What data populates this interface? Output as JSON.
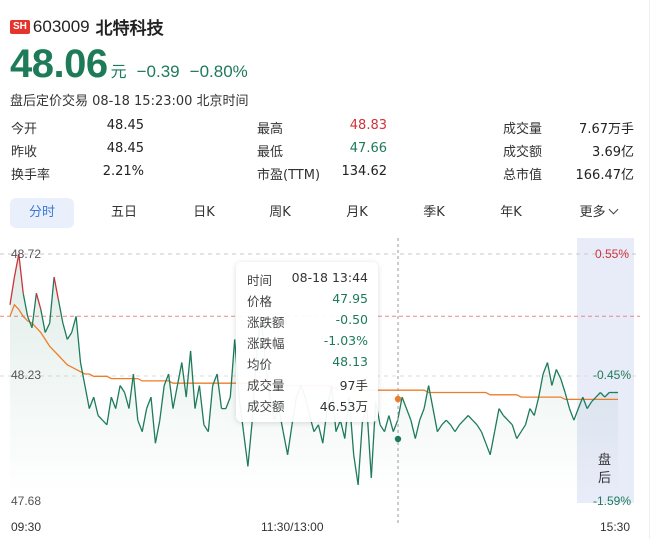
{
  "header": {
    "exchange": "SH",
    "code": "603009",
    "name": "北特科技"
  },
  "quote": {
    "price": "48.06",
    "unit": "元",
    "change": "−0.39",
    "change_pct": "−0.80%",
    "status": "盘后定价交易 08-18 15:23:00 北京时间"
  },
  "stats": [
    {
      "label": "今开",
      "value": "48.45"
    },
    {
      "label": "最高",
      "value": "48.83",
      "color": "#d0323a"
    },
    {
      "label": "成交量",
      "value": "7.67万手"
    },
    {
      "label": "昨收",
      "value": "48.45"
    },
    {
      "label": "最低",
      "value": "47.66",
      "color": "#1e7b5a"
    },
    {
      "label": "成交额",
      "value": "3.69亿"
    },
    {
      "label": "换手率",
      "value": "2.21%"
    },
    {
      "label": "市盈(TTM)",
      "value": "134.62"
    },
    {
      "label": "总市值",
      "value": "166.47亿"
    }
  ],
  "tabs": [
    "分时",
    "五日",
    "日K",
    "周K",
    "月K",
    "季K",
    "年K",
    "更多"
  ],
  "chart": {
    "y_top_label": "48.72",
    "y_mid_label": "48.23",
    "y_bottom_label": "47.68",
    "pct_top_label": "0.55%",
    "pct_mid_label": "-0.45%",
    "pct_bottom_label": "-1.59%",
    "x_labels": [
      "09:30",
      "11:30/13:00",
      "15:30"
    ],
    "after_hours_label": "盘\n后",
    "colors": {
      "price": "#1e7b5a",
      "average": "#ee7d2a",
      "up": "#d0323a",
      "after_hours": "#e8ebf8"
    }
  },
  "chart_data": {
    "type": "line",
    "ylim": [
      47.68,
      48.72
    ],
    "prev_close": 48.45,
    "series": [
      {
        "values": [
          48.5,
          48.62,
          48.72,
          48.55,
          48.45,
          48.4,
          48.55,
          48.48,
          48.38,
          48.42,
          48.62,
          48.52,
          48.42,
          48.35,
          48.38,
          48.45,
          48.25,
          48.15,
          48.05,
          48.1,
          48.02,
          48.0,
          47.98,
          48.1,
          48.05,
          48.15,
          48.12,
          48.05,
          48.2,
          48.0,
          47.95,
          48.05,
          48.1,
          47.9,
          48.0,
          48.15,
          48.2,
          48.05,
          48.15,
          48.25,
          48.1,
          48.3,
          48.05,
          48.15,
          47.98,
          47.95,
          48.15,
          48.2,
          48.05,
          48.05,
          48.1,
          48.35,
          48.1,
          47.95,
          47.8,
          48.0,
          48.3,
          48.45,
          48.25,
          48.1,
          48.0,
          48.05,
          47.95,
          47.85,
          47.98,
          48.1,
          48.15,
          48.1,
          48.02,
          47.95,
          47.98,
          47.9,
          48.05,
          48.15,
          47.95,
          48.0,
          47.92,
          48.1,
          47.85,
          47.72,
          48.0,
          48.05,
          47.75,
          48.08,
          47.98,
          47.95,
          48.02,
          47.95,
          48.0,
          48.1,
          48.05,
          48.0,
          47.92,
          48.0,
          48.05,
          48.15,
          48.05,
          47.95,
          47.98,
          48.0,
          47.98,
          47.95,
          47.98,
          48.0,
          48.02,
          48.0,
          47.98,
          47.95,
          47.9,
          47.85,
          47.95,
          48.05,
          48.02,
          48.0,
          47.98,
          47.92,
          47.95,
          47.98,
          48.05,
          48.02,
          48.1,
          48.2,
          48.25,
          48.15,
          48.22,
          48.18,
          48.12,
          48.05,
          48.0,
          48.05,
          48.1,
          48.05,
          48.08,
          48.1,
          48.12,
          48.1,
          48.12,
          48.12,
          48.12
        ],
        "color": "#1e7b5a"
      },
      {
        "values": [
          48.45,
          48.5,
          48.48,
          48.45,
          48.43,
          48.42,
          48.4,
          48.38,
          48.35,
          48.32,
          48.3,
          48.28,
          48.26,
          48.24,
          48.23,
          48.22,
          48.21,
          48.2,
          48.2,
          48.19,
          48.19,
          48.19,
          48.19,
          48.18,
          48.18,
          48.18,
          48.18,
          48.18,
          48.18,
          48.18,
          48.17,
          48.17,
          48.17,
          48.17,
          48.17,
          48.17,
          48.17,
          48.16,
          48.16,
          48.16,
          48.16,
          48.16,
          48.16,
          48.16,
          48.16,
          48.16,
          48.16,
          48.16,
          48.16,
          48.16,
          48.16,
          48.16,
          48.16,
          48.16,
          48.16,
          48.16,
          48.16,
          48.16,
          48.16,
          48.16,
          48.15,
          48.15,
          48.15,
          48.15,
          48.15,
          48.15,
          48.15,
          48.15,
          48.15,
          48.15,
          48.15,
          48.15,
          48.15,
          48.14,
          48.14,
          48.14,
          48.14,
          48.14,
          48.14,
          48.14,
          48.13,
          48.13,
          48.13,
          48.13,
          48.13,
          48.13,
          48.13,
          48.13,
          48.13,
          48.13,
          48.13,
          48.13,
          48.13,
          48.13,
          48.13,
          48.12,
          48.12,
          48.12,
          48.12,
          48.12,
          48.12,
          48.12,
          48.12,
          48.12,
          48.12,
          48.12,
          48.12,
          48.12,
          48.12,
          48.11,
          48.11,
          48.11,
          48.11,
          48.11,
          48.11,
          48.11,
          48.1,
          48.1,
          48.1,
          48.1,
          48.1,
          48.1,
          48.1,
          48.1,
          48.1,
          48.1,
          48.09,
          48.09,
          48.09,
          48.09,
          48.09,
          48.09,
          48.09,
          48.09,
          48.09,
          48.09,
          48.09,
          48.09,
          48.09
        ],
        "color": "#ee7d2a"
      }
    ]
  },
  "tooltip": [
    {
      "k": "时间",
      "v": "08-18 13:44"
    },
    {
      "k": "价格",
      "v": "47.95",
      "g": true
    },
    {
      "k": "涨跌额",
      "v": "-0.50",
      "g": true
    },
    {
      "k": "涨跌幅",
      "v": "-1.03%",
      "g": true
    },
    {
      "k": "均价",
      "v": "48.13",
      "g": true
    },
    {
      "k": "成交量",
      "v": "97手"
    },
    {
      "k": "成交额",
      "v": "46.53万"
    }
  ]
}
